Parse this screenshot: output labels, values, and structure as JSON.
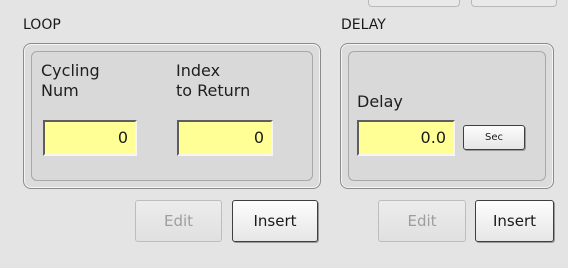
{
  "loop": {
    "title": "LOOP",
    "cycling_num": {
      "label_line1": "Cycling",
      "label_line2": "Num",
      "value": "0"
    },
    "index_to_return": {
      "label_line1": "Index",
      "label_line2": "to Return",
      "value": "0"
    },
    "edit_label": "Edit",
    "insert_label": "Insert"
  },
  "delay": {
    "title": "DELAY",
    "field_label": "Delay",
    "value": "0.0",
    "unit_button_label": "Sec",
    "edit_label": "Edit",
    "insert_label": "Insert"
  },
  "colors": {
    "field_background": "#ffff96",
    "panel_background": "#dcdcdc",
    "window_background": "#e4e4e4",
    "disabled_text": "#9e9e9e"
  }
}
